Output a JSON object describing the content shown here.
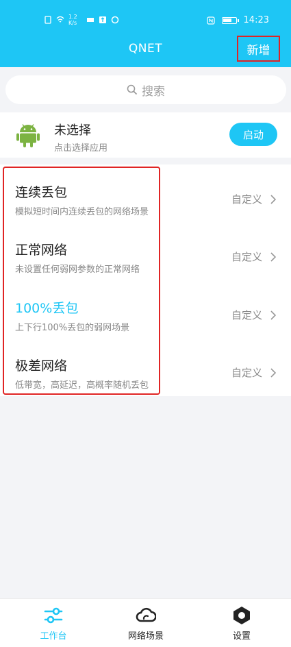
{
  "status_bar": {
    "speed": "1.2 K/s",
    "time": "14:23"
  },
  "header": {
    "title": "QNET",
    "add_label": "新增"
  },
  "search": {
    "placeholder": "搜索"
  },
  "app": {
    "name": "未选择",
    "subtitle": "点击选择应用",
    "start_label": "启动"
  },
  "scenes": [
    {
      "title": "连续丢包",
      "desc": "模拟短时间内连续丢包的网络场景",
      "action": "自定义",
      "active": false
    },
    {
      "title": "正常网络",
      "desc": "未设置任何弱网参数的正常网络",
      "action": "自定义",
      "active": false
    },
    {
      "title": "100%丢包",
      "desc": "上下行100%丢包的弱网场景",
      "action": "自定义",
      "active": true
    },
    {
      "title": "极差网络",
      "desc": "低带宽，高延迟，高概率随机丢包",
      "action": "自定义",
      "active": false
    }
  ],
  "tabs": [
    {
      "label": "工作台",
      "icon": "sliders-icon",
      "active": true
    },
    {
      "label": "网络场景",
      "icon": "cloud-icon",
      "active": false
    },
    {
      "label": "设置",
      "icon": "settings-icon",
      "active": false
    }
  ],
  "colors": {
    "accent": "#1ec6f5",
    "highlight_border": "#e02424",
    "android_green": "#7cb342"
  }
}
